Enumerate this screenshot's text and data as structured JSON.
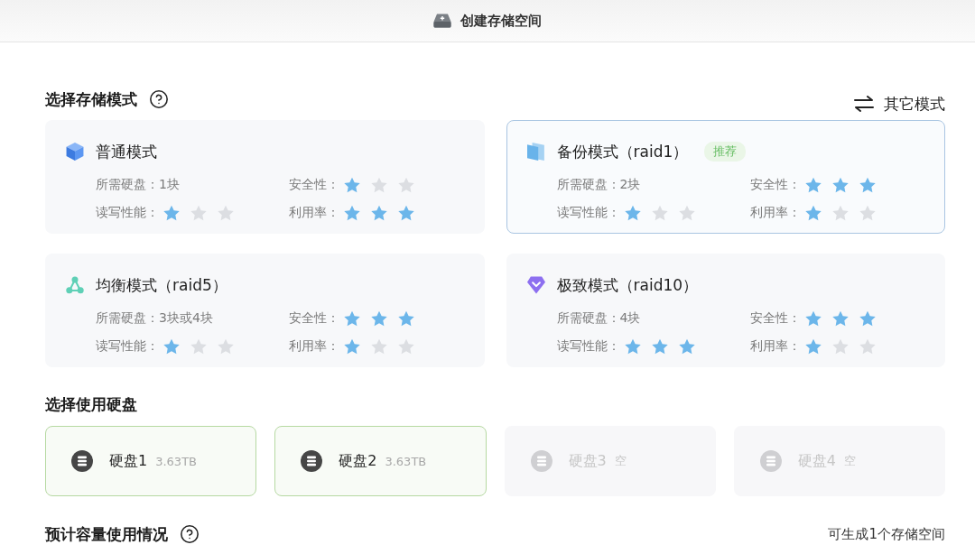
{
  "window": {
    "title": "创建存储空间"
  },
  "mode_section": {
    "title": "选择存储模式",
    "other_modes": "其它模式"
  },
  "modes": [
    {
      "kind": "basic",
      "name": "普通模式",
      "selected": false,
      "specs": [
        {
          "kind": "text",
          "text": "所需硬盘：1块"
        },
        {
          "kind": "stars",
          "label": "安全性：",
          "stars": 1
        },
        {
          "kind": "stars",
          "label": "读写性能：",
          "stars": 1
        },
        {
          "kind": "stars",
          "label": "利用率：",
          "stars": 3
        }
      ]
    },
    {
      "kind": "mirror",
      "name": "备份模式（raid1）",
      "badge": "推荐",
      "selected": true,
      "specs": [
        {
          "kind": "text",
          "text": "所需硬盘：2块"
        },
        {
          "kind": "stars",
          "label": "安全性：",
          "stars": 3
        },
        {
          "kind": "stars",
          "label": "读写性能：",
          "stars": 1
        },
        {
          "kind": "stars",
          "label": "利用率：",
          "stars": 1
        }
      ]
    },
    {
      "kind": "parity",
      "name": "均衡模式（raid5）",
      "selected": false,
      "specs": [
        {
          "kind": "text",
          "text": "所需硬盘：3块或4块"
        },
        {
          "kind": "stars",
          "label": "安全性：",
          "stars": 3
        },
        {
          "kind": "stars",
          "label": "读写性能：",
          "stars": 1
        },
        {
          "kind": "stars",
          "label": "利用率：",
          "stars": 1
        }
      ]
    },
    {
      "kind": "striped",
      "name": "极致模式（raid10）",
      "selected": false,
      "specs": [
        {
          "kind": "text",
          "text": "所需硬盘：4块"
        },
        {
          "kind": "stars",
          "label": "安全性：",
          "stars": 3
        },
        {
          "kind": "stars",
          "label": "读写性能：",
          "stars": 3
        },
        {
          "kind": "stars",
          "label": "利用率：",
          "stars": 1
        }
      ]
    }
  ],
  "disk_section": {
    "title": "选择使用硬盘"
  },
  "disks": [
    {
      "name": "硬盘1",
      "size": "3.63TB",
      "selected": true,
      "disabled": false
    },
    {
      "name": "硬盘2",
      "size": "3.63TB",
      "selected": true,
      "disabled": false
    },
    {
      "name": "硬盘3",
      "size": "空",
      "selected": false,
      "disabled": true
    },
    {
      "name": "硬盘4",
      "size": "空",
      "selected": false,
      "disabled": true
    }
  ],
  "capacity_section": {
    "title": "预计容量使用情况",
    "summary": "可生成1个存储空间"
  }
}
